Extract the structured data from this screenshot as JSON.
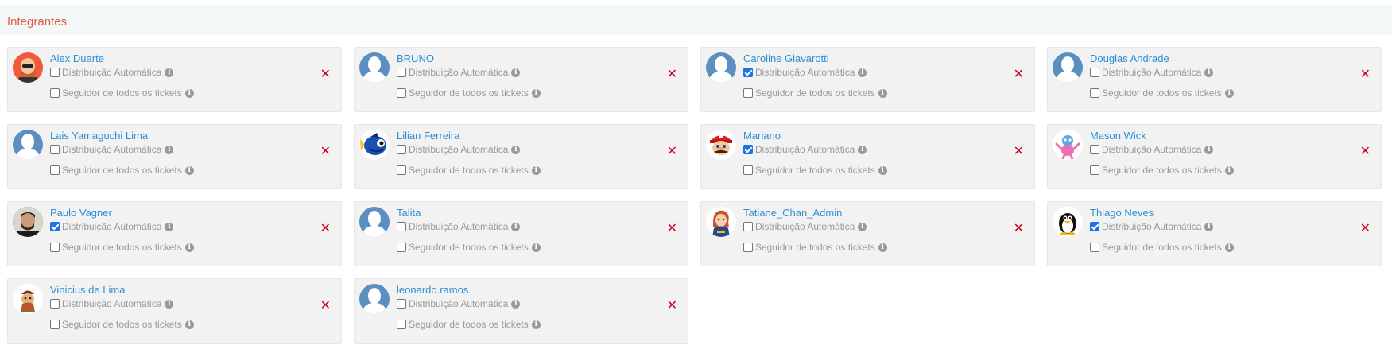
{
  "section": {
    "title": "Integrantes"
  },
  "labels": {
    "auto_distribution": "Distribuição Automática",
    "follower_all": "Seguidor de todos os tickets",
    "info_glyph": "i",
    "remove_glyph": "✕"
  },
  "members": [
    {
      "name": "Alex Duarte",
      "avatar": "cartoon-bald-man-avatar",
      "auto_distribution": false,
      "follower_all": false
    },
    {
      "name": "BRUNO",
      "avatar": "default-user-avatar",
      "auto_distribution": false,
      "follower_all": false
    },
    {
      "name": "Caroline Giavarotti",
      "avatar": "default-user-avatar",
      "auto_distribution": true,
      "follower_all": false
    },
    {
      "name": "Douglas Andrade",
      "avatar": "default-user-avatar",
      "auto_distribution": false,
      "follower_all": false
    },
    {
      "name": "Lais Yamaguchi Lima",
      "avatar": "default-user-avatar",
      "auto_distribution": false,
      "follower_all": false
    },
    {
      "name": "Lilian Ferreira",
      "avatar": "blue-fish-avatar",
      "auto_distribution": false,
      "follower_all": false
    },
    {
      "name": "Mariano",
      "avatar": "plumber-cartoon-avatar",
      "auto_distribution": true,
      "follower_all": false
    },
    {
      "name": "Mason Wick",
      "avatar": "pink-creature-avatar",
      "auto_distribution": false,
      "follower_all": false
    },
    {
      "name": "Paulo Vagner",
      "avatar": "photo-man-avatar",
      "auto_distribution": true,
      "follower_all": false
    },
    {
      "name": "Talita",
      "avatar": "default-user-avatar",
      "auto_distribution": false,
      "follower_all": false
    },
    {
      "name": "Tatiane_Chan_Admin",
      "avatar": "redhead-cartoon-avatar",
      "auto_distribution": false,
      "follower_all": false
    },
    {
      "name": "Thiago Neves",
      "avatar": "penguin-avatar",
      "auto_distribution": true,
      "follower_all": false
    },
    {
      "name": "Vinicius de Lima",
      "avatar": "brown-cartoon-avatar",
      "auto_distribution": false,
      "follower_all": false
    },
    {
      "name": "leonardo.ramos",
      "avatar": "default-user-avatar",
      "auto_distribution": false,
      "follower_all": false
    }
  ],
  "colors": {
    "accent_title": "#e15a3f",
    "name_link": "#2a8fd6",
    "remove": "#d0021b",
    "default_avatar": "#5b8fbf"
  }
}
